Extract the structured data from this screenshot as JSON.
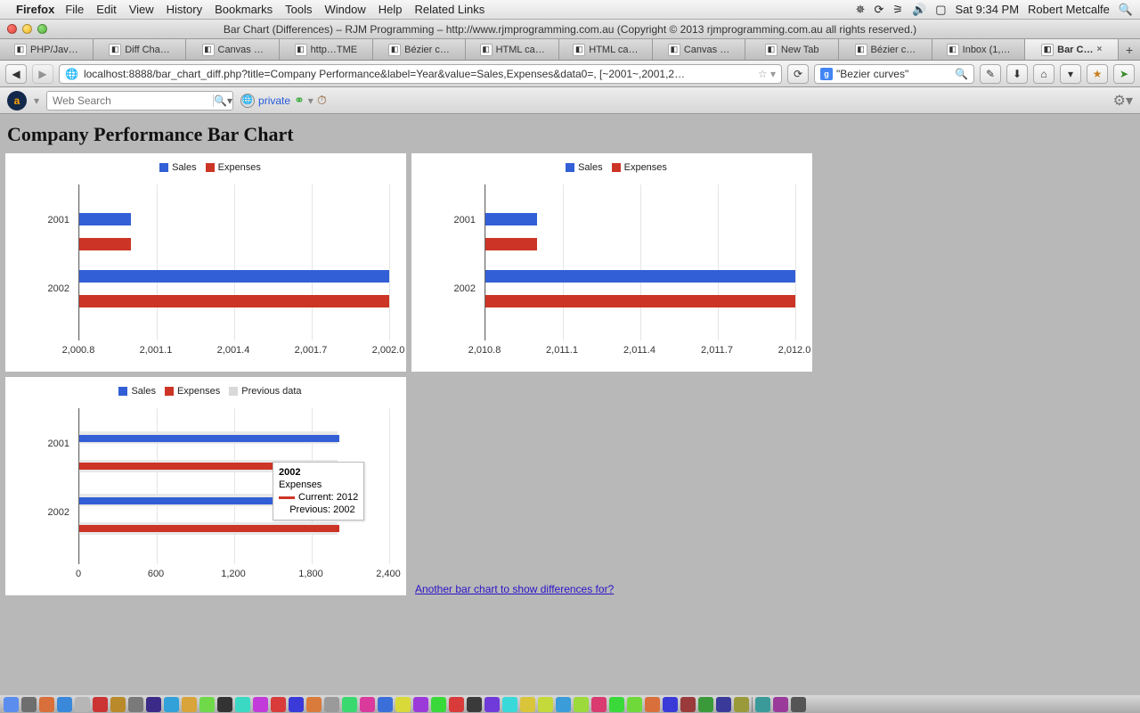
{
  "menubar": {
    "app": "Firefox",
    "menus": [
      "File",
      "Edit",
      "View",
      "History",
      "Bookmarks",
      "Tools",
      "Window",
      "Help",
      "Related Links"
    ],
    "right": {
      "clock": "Sat 9:34 PM",
      "user": "Robert Metcalfe"
    }
  },
  "window": {
    "title": "Bar Chart (Differences) – RJM Programming – http://www.rjmprogramming.com.au (Copyright © 2013 rjmprogramming.com.au all rights reserved.)"
  },
  "tabs": [
    {
      "label": "PHP/Jav…"
    },
    {
      "label": "Diff Cha…"
    },
    {
      "label": "Canvas …"
    },
    {
      "label": "http…TME"
    },
    {
      "label": "Bézier c…"
    },
    {
      "label": "HTML ca…"
    },
    {
      "label": "HTML ca…"
    },
    {
      "label": "Canvas …"
    },
    {
      "label": "New Tab"
    },
    {
      "label": "Bézier c…"
    },
    {
      "label": "Inbox (1,…"
    },
    {
      "label": "Bar C…",
      "active": true
    }
  ],
  "nav": {
    "url": "localhost:8888/bar_chart_diff.php?title=Company Performance&label=Year&value=Sales,Expenses&data0=, [~2001~,2001,2…",
    "search": "\"Bezier curves\""
  },
  "toolbar2": {
    "websearch_placeholder": "Web Search",
    "private_label": "private"
  },
  "page": {
    "title": "Company Performance Bar Chart",
    "link": "Another bar chart to show differences for?"
  },
  "legend": {
    "sales": "Sales",
    "expenses": "Expenses",
    "prev": "Previous data"
  },
  "tooltip": {
    "year": "2002",
    "metric": "Expenses",
    "current_label": "Current:",
    "current_val": "2012",
    "prev_label": "Previous:",
    "prev_val": "2002"
  },
  "chart_data": [
    {
      "type": "bar",
      "orientation": "horizontal",
      "title": "",
      "categories": [
        "2001",
        "2002"
      ],
      "series": [
        {
          "name": "Sales",
          "values": [
            2001,
            2002
          ]
        },
        {
          "name": "Expenses",
          "values": [
            2001,
            2002
          ]
        }
      ],
      "xticks": [
        "2,000.8",
        "2,001.1",
        "2,001.4",
        "2,001.7",
        "2,002.0"
      ],
      "xlim": [
        2000.8,
        2002.0
      ]
    },
    {
      "type": "bar",
      "orientation": "horizontal",
      "title": "",
      "categories": [
        "2001",
        "2002"
      ],
      "series": [
        {
          "name": "Sales",
          "values": [
            2011,
            2012
          ]
        },
        {
          "name": "Expenses",
          "values": [
            2011,
            2012
          ]
        }
      ],
      "xticks": [
        "2,010.8",
        "2,011.1",
        "2,011.4",
        "2,011.7",
        "2,012.0"
      ],
      "xlim": [
        2010.8,
        2012.0
      ]
    },
    {
      "type": "bar_diff",
      "orientation": "horizontal",
      "title": "",
      "categories": [
        "2001",
        "2002"
      ],
      "series": [
        {
          "name": "Sales",
          "current": [
            2011,
            2012
          ],
          "previous": [
            2001,
            2002
          ]
        },
        {
          "name": "Expenses",
          "current": [
            2011,
            2012
          ],
          "previous": [
            2001,
            2002
          ]
        }
      ],
      "xticks": [
        "0",
        "600",
        "1,200",
        "1,800",
        "2,400"
      ],
      "xlim": [
        0,
        2400
      ],
      "legend_extra": "Previous data"
    }
  ]
}
